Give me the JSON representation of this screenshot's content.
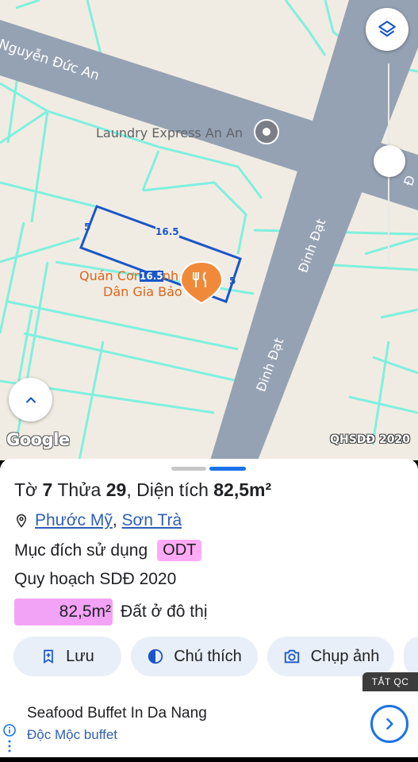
{
  "map": {
    "street_nguyen_duc_an": "Nguyễn Đức An",
    "street_dinh_dat": "Đinh Đạt",
    "street_dinh_dat_right_partial": "Đ",
    "poi_laundry": "Laundry Express An An",
    "poi_restaurant_line1": "Quán Cơm Bình",
    "poi_restaurant_line2": "Dân Gia Bảo",
    "edge_top": "16.5",
    "edge_bottom": "16.5",
    "edge_left": "5",
    "edge_right": "5",
    "google_logo": "Google",
    "layer_tag": "QHSDĐ 2020",
    "colors": {
      "parcel_border": "#1a56c8",
      "road": "#95a2b3",
      "grid_lines": "#7ff0de",
      "poi_orange": "#f08a3a"
    }
  },
  "sheet": {
    "to_label": "Tờ",
    "to_value": "7",
    "thua_label": "Thửa",
    "thua_value": "29",
    "dien_tich_label": "Diện tích",
    "dien_tich_value": "82,5m²",
    "ward": "Phước Mỹ",
    "district": "Sơn Trà",
    "purpose_label": "Mục đích sử dụng",
    "purpose_code": "ODT",
    "plan_label": "Quy hoạch SDĐ 2020",
    "area_value": "82,5m²",
    "area_desc": "Đất ở đô thị",
    "buttons": {
      "save": "Lưu",
      "legend": "Chú thích",
      "capture": "Chụp ảnh"
    }
  },
  "ad": {
    "close_label": "TẮT QC",
    "title": "Seafood Buffet In Da Nang",
    "subtitle": "Độc Mộc buffet"
  }
}
